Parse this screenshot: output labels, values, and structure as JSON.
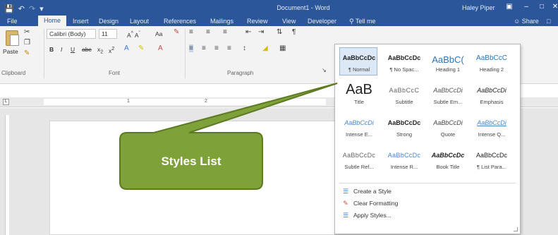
{
  "window": {
    "title": "Document1 - Word",
    "user": "Haley Piper",
    "accent": "#2b579a"
  },
  "quick_access": {
    "save_icon": "save-icon",
    "undo_icon": "undo-icon",
    "redo_icon": "redo-icon",
    "customize_icon": "customize-qat-icon"
  },
  "tabs": [
    {
      "label": "File"
    },
    {
      "label": "Home"
    },
    {
      "label": "Insert"
    },
    {
      "label": "Design"
    },
    {
      "label": "Layout"
    },
    {
      "label": "References"
    },
    {
      "label": "Mailings"
    },
    {
      "label": "Review"
    },
    {
      "label": "View"
    },
    {
      "label": "Developer"
    }
  ],
  "tell_me": "Tell me",
  "share": "Share",
  "ribbon": {
    "clipboard": {
      "paste_label": "Paste",
      "group_label": "Clipboard"
    },
    "font": {
      "font_name": "Calibri (Body)",
      "font_size": "11",
      "case_button": "Aa",
      "group_label": "Font"
    },
    "paragraph": {
      "group_label": "Paragraph"
    }
  },
  "styles_gallery": {
    "rows": [
      [
        {
          "preview": "AaBbCcDc",
          "name": "¶ Normal",
          "selected": true
        },
        {
          "preview": "AaBbCcDc",
          "name": "¶ No Spac..."
        },
        {
          "preview": "AaBbC(",
          "name": "Heading 1"
        },
        {
          "preview": "AaBbCcC",
          "name": "Heading 2"
        }
      ],
      [
        {
          "preview": "AaB",
          "name": "Title"
        },
        {
          "preview": "AaBbCcC",
          "name": "Subtitle"
        },
        {
          "preview": "AaBbCcDi",
          "name": "Subtle Em..."
        },
        {
          "preview": "AaBbCcDi",
          "name": "Emphasis"
        }
      ],
      [
        {
          "preview": "AaBbCcDi",
          "name": "Intense E..."
        },
        {
          "preview": "AaBbCcDc",
          "name": "Strong"
        },
        {
          "preview": "AaBbCcDi",
          "name": "Quote"
        },
        {
          "preview": "AaBbCcDi",
          "name": "Intense Q..."
        }
      ],
      [
        {
          "preview": "AaBbCcDc",
          "name": "Subtle Ref..."
        },
        {
          "preview": "AaBbCcDc",
          "name": "Intense R..."
        },
        {
          "preview": "AaBbCcDc",
          "name": "Book Title"
        },
        {
          "preview": "AaBbCcDc",
          "name": "¶ List Para..."
        }
      ]
    ],
    "commands": [
      {
        "label": "Create a Style",
        "icon": "create-style-icon"
      },
      {
        "label": "Clear Formatting",
        "icon": "clear-formatting-icon"
      },
      {
        "label": "Apply Styles...",
        "icon": "apply-styles-icon"
      }
    ]
  },
  "callout": {
    "text": "Styles List",
    "fill": "#7ea13a",
    "stroke": "#5d7a22"
  }
}
